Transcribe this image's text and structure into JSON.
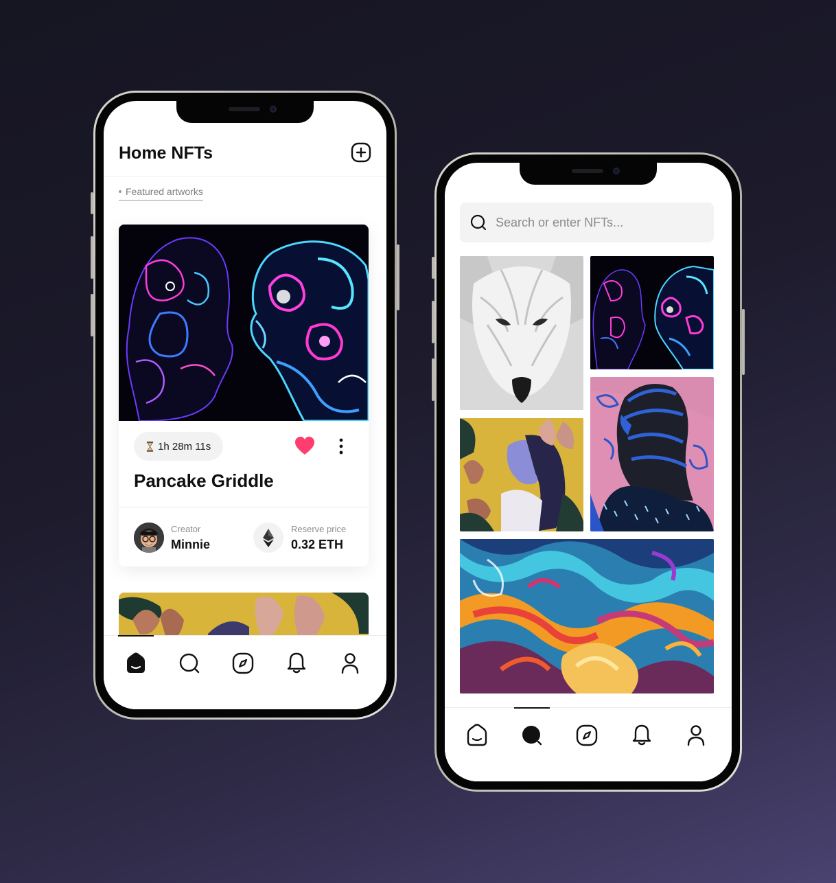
{
  "home": {
    "title": "Home NFTs",
    "featured_tab": "Featured artworks",
    "card": {
      "timer": "1h 28m 11s",
      "title": "Pancake Griddle",
      "creator_label": "Creator",
      "creator_name": "Minnie",
      "price_label": "Reserve price",
      "price_value": "0.32 ETH",
      "liked": true
    },
    "tabs": [
      "home",
      "search",
      "explore",
      "notifications",
      "profile"
    ],
    "active_tab": "home"
  },
  "search": {
    "placeholder": "Search or enter NFTs...",
    "grid": [
      "white-wolf-art",
      "neon-faces-art",
      "woman-flowers-art",
      "blue-portrait-art",
      "fluid-marble-art"
    ],
    "tabs": [
      "home",
      "search",
      "explore",
      "notifications",
      "profile"
    ],
    "active_tab": "search"
  },
  "colors": {
    "heart": "#ff3d6e",
    "background_dark": "#161522",
    "background_purple": "#4a4270"
  }
}
